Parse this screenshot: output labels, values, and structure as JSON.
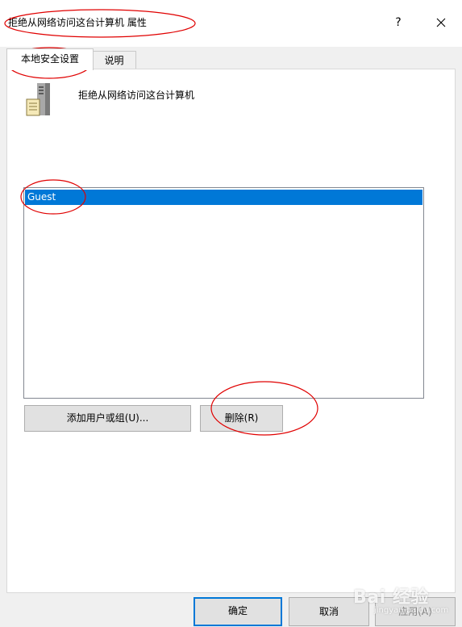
{
  "window": {
    "title": "拒绝从网络访问这台计算机 属性",
    "help_label": "?",
    "close_icon": "close-icon"
  },
  "tabs": [
    {
      "label": "本地安全设置",
      "active": true
    },
    {
      "label": "说明",
      "active": false
    }
  ],
  "policy": {
    "icon": "server-computer-icon",
    "name": "拒绝从网络访问这台计算机"
  },
  "members": {
    "items": [
      {
        "label": "Guest",
        "selected": true
      }
    ]
  },
  "actions": {
    "add_label": "添加用户或组(U)...",
    "remove_label": "删除(R)"
  },
  "footer": {
    "ok_label": "确定",
    "cancel_label": "取消",
    "apply_label": "应用(A)"
  },
  "watermark": {
    "brand": "Bai 经验",
    "site": "jingyan.baidu.com"
  },
  "colors": {
    "selection": "#0078d7",
    "annotation": "#e00000"
  }
}
